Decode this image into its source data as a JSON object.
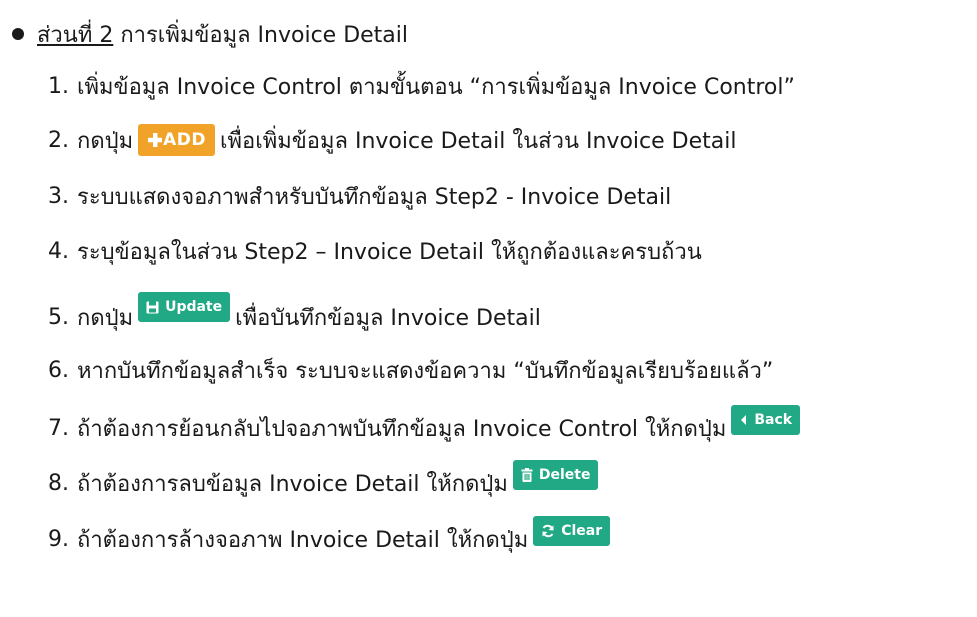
{
  "heading": {
    "section_label": "ส่วนที่ 2",
    "title": "การเพิ่มข้อมูล Invoice Detail"
  },
  "steps": [
    {
      "num": "1.",
      "text": "เพิ่มข้อมูล Invoice Control ตามขั้นตอน “การเพิ่มข้อมูล Invoice Control”"
    },
    {
      "num": "2.",
      "before": "กดปุ่ม",
      "button": "ADD",
      "after": "เพื่อเพิ่มข้อมูล Invoice Detail ในส่วน Invoice Detail"
    },
    {
      "num": "3.",
      "text": "ระบบแสดงจอภาพสำหรับบันทึกข้อมูล Step2 - Invoice Detail"
    },
    {
      "num": "4.",
      "text": "ระบุข้อมูลในส่วน Step2 – Invoice Detail ให้ถูกต้องและครบถ้วน"
    },
    {
      "num": "5.",
      "before": "กดปุ่ม",
      "button": "Update",
      "after": "เพื่อบันทึกข้อมูล Invoice Detail"
    },
    {
      "num": "6.",
      "text": "หากบันทึกข้อมูลสำเร็จ ระบบจะแสดงข้อความ “บันทึกข้อมูลเรียบร้อยแล้ว”"
    },
    {
      "num": "7.",
      "before": "ถ้าต้องการย้อนกลับไปจอภาพบันทึกข้อมูล Invoice Control ให้กดปุ่ม",
      "button": "Back"
    },
    {
      "num": "8.",
      "before": "ถ้าต้องการลบข้อมูล Invoice Detail ให้กดปุ่ม",
      "button": "Delete"
    },
    {
      "num": "9.",
      "before": "ถ้าต้องการล้างจอภาพ Invoice Detail ให้กดปุ่ม",
      "button": "Clear"
    }
  ],
  "icons": {
    "add": "plus-icon",
    "update": "save-icon",
    "back": "chevron-left-icon",
    "delete": "trash-icon",
    "clear": "refresh-icon"
  },
  "colors": {
    "add_button": "#f0a328",
    "action_button": "#21a884"
  }
}
